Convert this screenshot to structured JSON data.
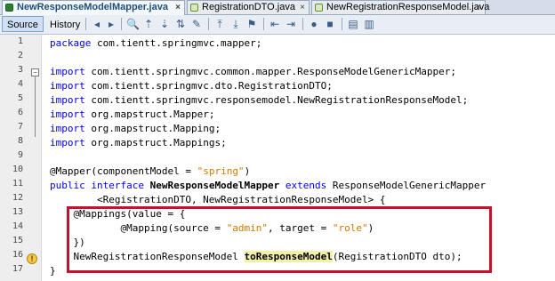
{
  "tabs": [
    {
      "label": "NewResponseModelMapper.java",
      "close": "×",
      "icon": "java-file-icon",
      "active": true
    },
    {
      "label": "RegistrationDTO.java",
      "close": "×",
      "icon": "java-file-icon",
      "active": false
    },
    {
      "label": "NewRegistrationResponseModel.java",
      "close": "×",
      "icon": "java-file-icon",
      "active": false
    }
  ],
  "toolbar": {
    "source_label": "Source",
    "history_label": "History"
  },
  "gutter": {
    "line_numbers": [
      "1",
      "2",
      "3",
      "4",
      "5",
      "6",
      "7",
      "8",
      "9",
      "10",
      "11",
      "12",
      "13",
      "14",
      "15",
      "16",
      "17"
    ],
    "fold_toggle": "−"
  },
  "code": {
    "l1_kw": "package",
    "l1_rest": " com.tientt.springmvc.mapper;",
    "l3_kw": "import",
    "l3_rest": " com.tientt.springmvc.common.mapper.ResponseModelGenericMapper;",
    "l4_kw": "import",
    "l4_rest": " com.tientt.springmvc.dto.RegistrationDTO;",
    "l5_kw": "import",
    "l5_rest": " com.tientt.springmvc.responsemodel.NewRegistrationResponseModel;",
    "l6_kw": "import",
    "l6_rest": " org.mapstruct.Mapper;",
    "l7_kw": "import",
    "l7_rest": " org.mapstruct.Mapping;",
    "l8_kw": "import",
    "l8_rest": " org.mapstruct.Mappings;",
    "l10_a": "@Mapper(componentModel = ",
    "l10_s": "\"spring\"",
    "l10_b": ")",
    "l11_kw1": "public interface",
    "l11_name": " NewResponseModelMapper",
    "l11_kw2": " extends",
    "l11_rest": " ResponseModelGenericMapper",
    "l12": "        <RegistrationDTO, NewRegistrationResponseModel> {",
    "l13": "    @Mappings(value = {",
    "l14_a": "            @Mapping(source = ",
    "l14_s1": "\"admin\"",
    "l14_b": ", target = ",
    "l14_s2": "\"role\"",
    "l14_c": ")",
    "l15": "    })",
    "l16_a": "    NewRegistrationResponseModel ",
    "l16_m": "toResponseModel",
    "l16_b": "(RegistrationDTO dto);",
    "l17": "}"
  },
  "colors": {
    "keyword": "#0000e6",
    "string": "#ce7b00",
    "highlight_box": "#c8102e",
    "method_highlight": "#f3f0a8"
  }
}
